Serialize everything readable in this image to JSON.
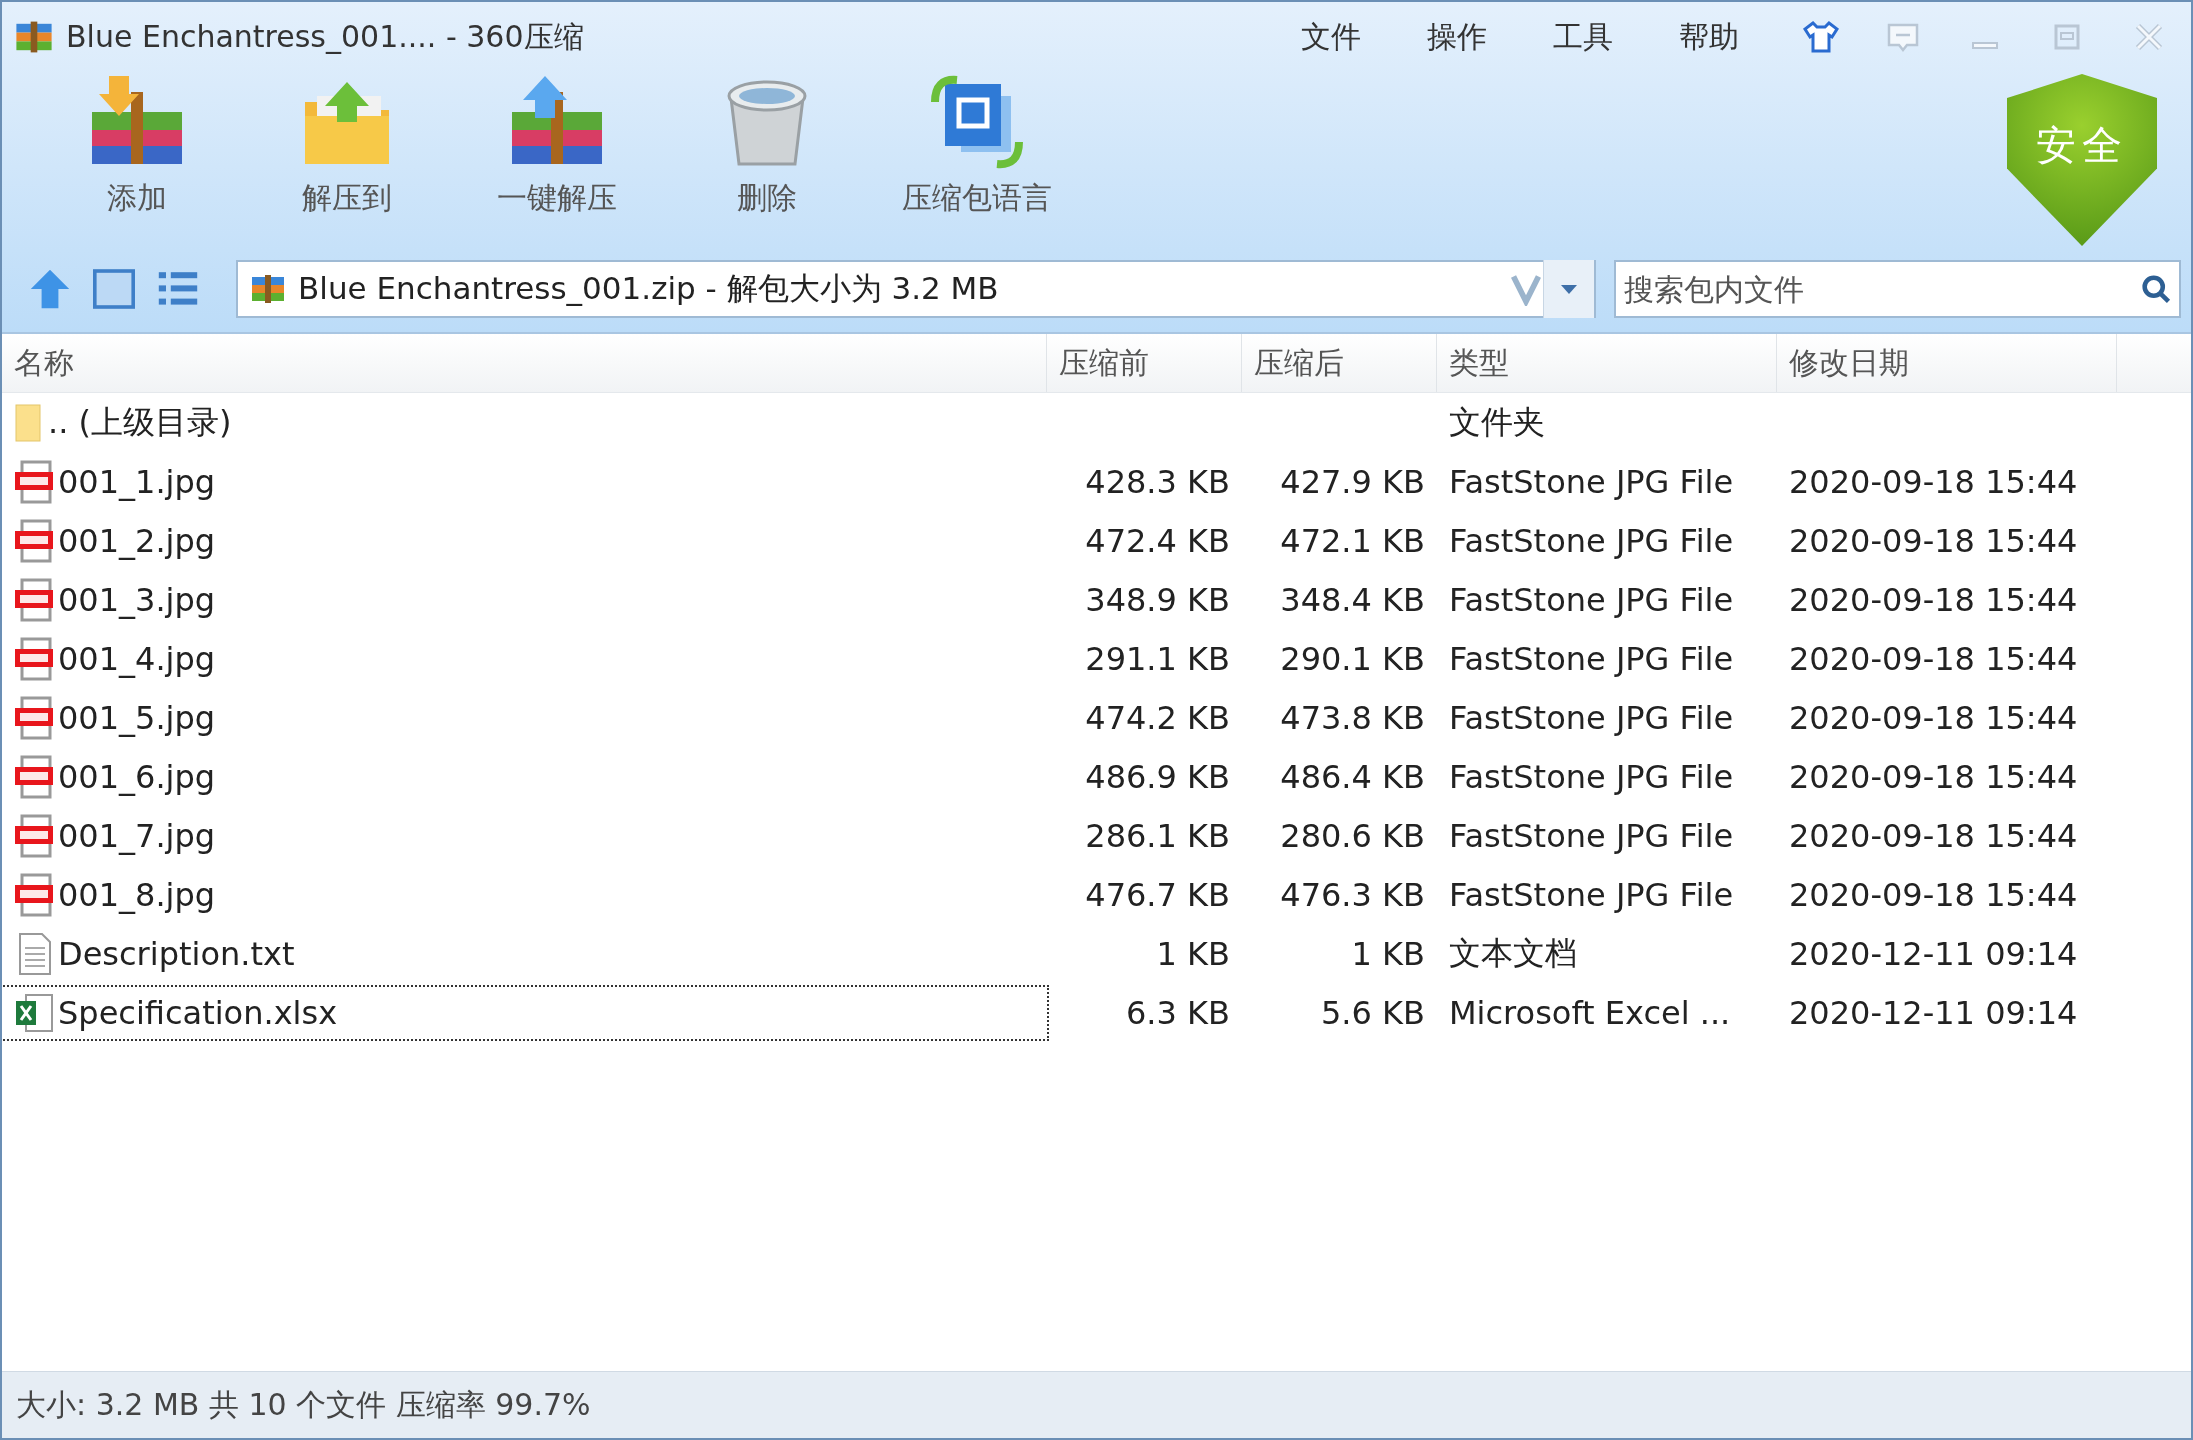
{
  "window": {
    "title": "Blue Enchantress_001.... - 360压缩"
  },
  "menu": [
    "文件",
    "操作",
    "工具",
    "帮助"
  ],
  "toolbar": [
    {
      "kind": "add",
      "label": "添加"
    },
    {
      "kind": "extract_to",
      "label": "解压到"
    },
    {
      "kind": "one_click",
      "label": "一键解压"
    },
    {
      "kind": "delete",
      "label": "删除"
    },
    {
      "kind": "encoding",
      "label": "压缩包语言"
    }
  ],
  "security_badge": "安全",
  "address": {
    "value": "Blue Enchantress_001.zip - 解包大小为 3.2 MB"
  },
  "search": {
    "placeholder": "搜索包内文件"
  },
  "table": {
    "columns": [
      "名称",
      "压缩前",
      "压缩后",
      "类型",
      "修改日期"
    ],
    "rows": [
      {
        "kind": "folder",
        "name": ".. (上级目录)",
        "before": "",
        "after": "",
        "type": "文件夹",
        "date": "",
        "selected": false
      },
      {
        "kind": "jpg",
        "name": "001_1.jpg",
        "before": "428.3 KB",
        "after": "427.9 KB",
        "type": "FastStone JPG File",
        "date": "2020-09-18 15:44",
        "selected": false
      },
      {
        "kind": "jpg",
        "name": "001_2.jpg",
        "before": "472.4 KB",
        "after": "472.1 KB",
        "type": "FastStone JPG File",
        "date": "2020-09-18 15:44",
        "selected": false
      },
      {
        "kind": "jpg",
        "name": "001_3.jpg",
        "before": "348.9 KB",
        "after": "348.4 KB",
        "type": "FastStone JPG File",
        "date": "2020-09-18 15:44",
        "selected": false
      },
      {
        "kind": "jpg",
        "name": "001_4.jpg",
        "before": "291.1 KB",
        "after": "290.1 KB",
        "type": "FastStone JPG File",
        "date": "2020-09-18 15:44",
        "selected": false
      },
      {
        "kind": "jpg",
        "name": "001_5.jpg",
        "before": "474.2 KB",
        "after": "473.8 KB",
        "type": "FastStone JPG File",
        "date": "2020-09-18 15:44",
        "selected": false
      },
      {
        "kind": "jpg",
        "name": "001_6.jpg",
        "before": "486.9 KB",
        "after": "486.4 KB",
        "type": "FastStone JPG File",
        "date": "2020-09-18 15:44",
        "selected": false
      },
      {
        "kind": "jpg",
        "name": "001_7.jpg",
        "before": "286.1 KB",
        "after": "280.6 KB",
        "type": "FastStone JPG File",
        "date": "2020-09-18 15:44",
        "selected": false
      },
      {
        "kind": "jpg",
        "name": "001_8.jpg",
        "before": "476.7 KB",
        "after": "476.3 KB",
        "type": "FastStone JPG File",
        "date": "2020-09-18 15:44",
        "selected": false
      },
      {
        "kind": "txt",
        "name": "Description.txt",
        "before": "1 KB",
        "after": "1 KB",
        "type": "文本文档",
        "date": "2020-12-11 09:14",
        "selected": false
      },
      {
        "kind": "xlsx",
        "name": "Specification.xlsx",
        "before": "6.3 KB",
        "after": "5.6 KB",
        "type": "Microsoft Excel ...",
        "date": "2020-12-11 09:14",
        "selected": true
      }
    ]
  },
  "status_bar": "大小: 3.2 MB 共 10 个文件 压缩率 99.7%"
}
